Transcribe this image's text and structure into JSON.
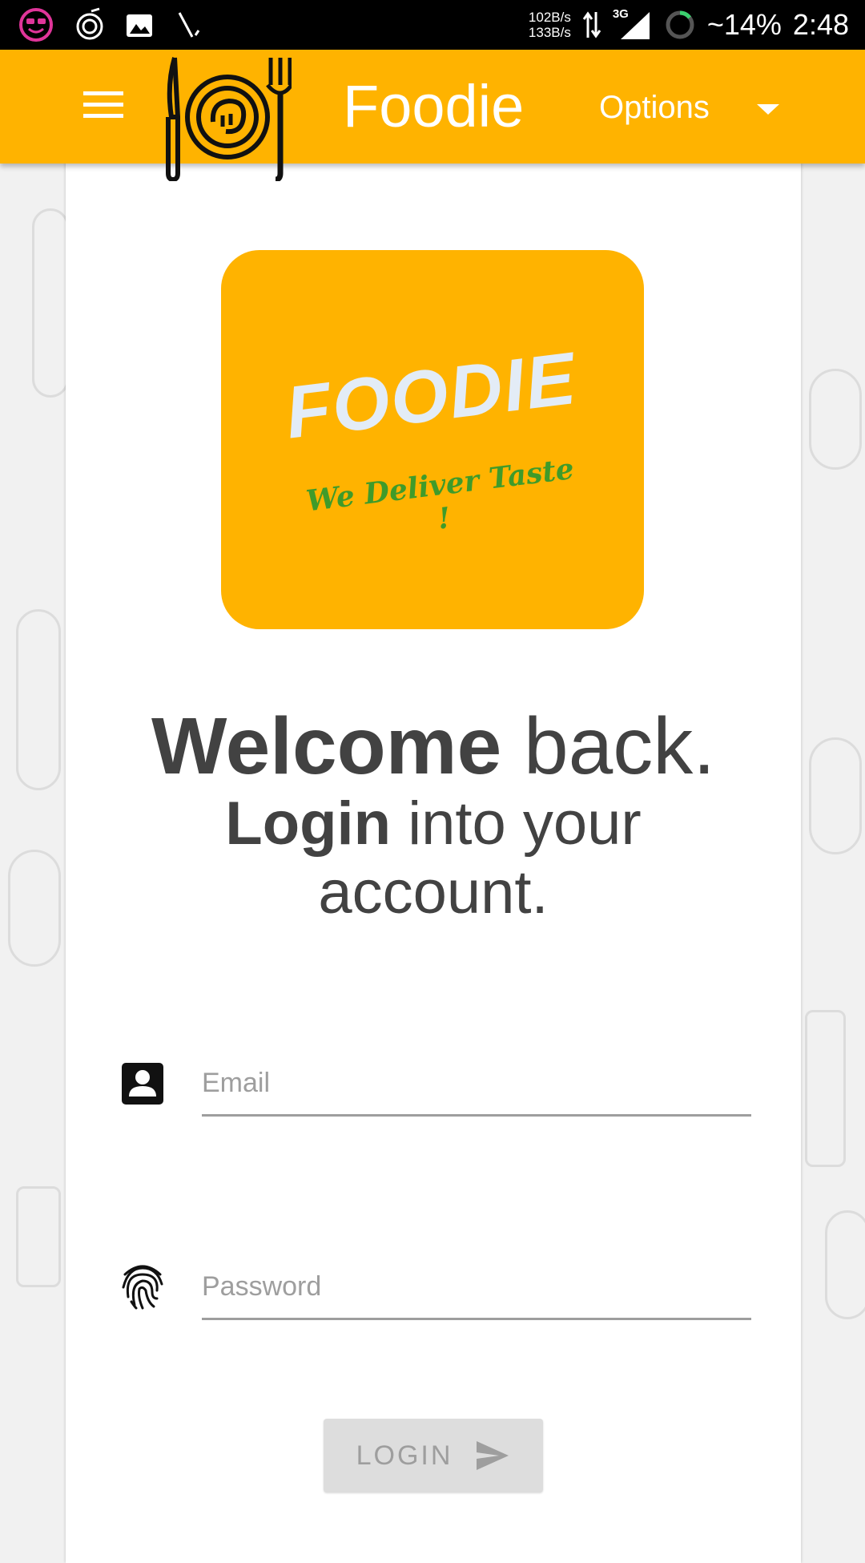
{
  "status_bar": {
    "net_up": "102B/s",
    "net_down": "133B/s",
    "network_type": "3G",
    "battery": "~14%",
    "time": "2:48"
  },
  "app_bar": {
    "title": "Foodie",
    "options_label": "Options"
  },
  "logo": {
    "name": "FOODIE",
    "tagline": "We Deliver Taste !"
  },
  "welcome": {
    "bold": "Welcome",
    "rest": " back."
  },
  "subtitle": {
    "bold": "Login",
    "rest": " into your",
    "line2": "account."
  },
  "form": {
    "email_placeholder": "Email",
    "password_placeholder": "Password",
    "login_label": "LOGIN"
  },
  "colors": {
    "primary": "#FFB300",
    "tagline_green": "#3f9b2a"
  }
}
